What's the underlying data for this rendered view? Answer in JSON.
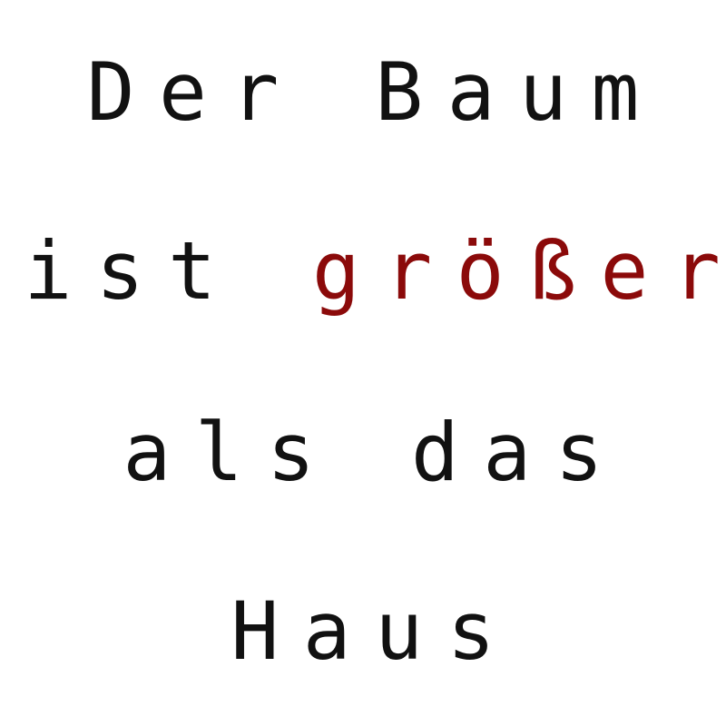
{
  "colors": {
    "text": "#111111",
    "highlight": "#8b0a0a",
    "background": "#ffffff"
  },
  "sentence": {
    "line1": "Der Baum",
    "line2_prefix": "ist ",
    "line2_highlight": "größer",
    "line3": "als das",
    "line4": "Haus"
  }
}
